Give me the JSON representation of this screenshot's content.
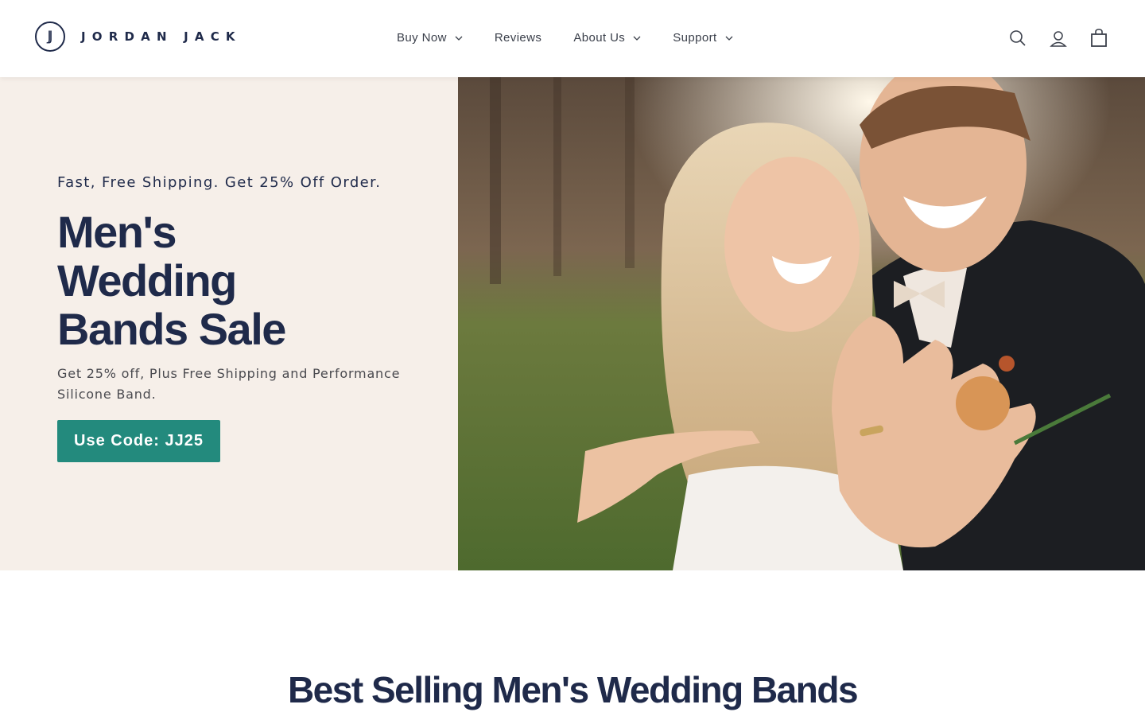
{
  "brand": {
    "logo_mark": "JJ",
    "name": "JORDAN JACK",
    "color": "#1f2a4a"
  },
  "nav": {
    "items": [
      {
        "label": "Buy Now",
        "has_dropdown": true
      },
      {
        "label": "Reviews",
        "has_dropdown": false
      },
      {
        "label": "About Us",
        "has_dropdown": true
      },
      {
        "label": "Support",
        "has_dropdown": true
      }
    ]
  },
  "header_icons": [
    "search-icon",
    "account-icon",
    "cart-icon"
  ],
  "hero": {
    "eyebrow": "Fast, Free Shipping. Get 25% Off Order.",
    "title_lines": [
      "Men's",
      "Wedding",
      "Bands Sale"
    ],
    "subtitle": "Get 25% off, Plus Free Shipping and Performance Silicone Band.",
    "cta_label": "Use Code: JJ25",
    "cta_color": "#238a7d",
    "background": "#f6efe9"
  },
  "section": {
    "title": "Best Selling Men's Wedding Bands"
  }
}
